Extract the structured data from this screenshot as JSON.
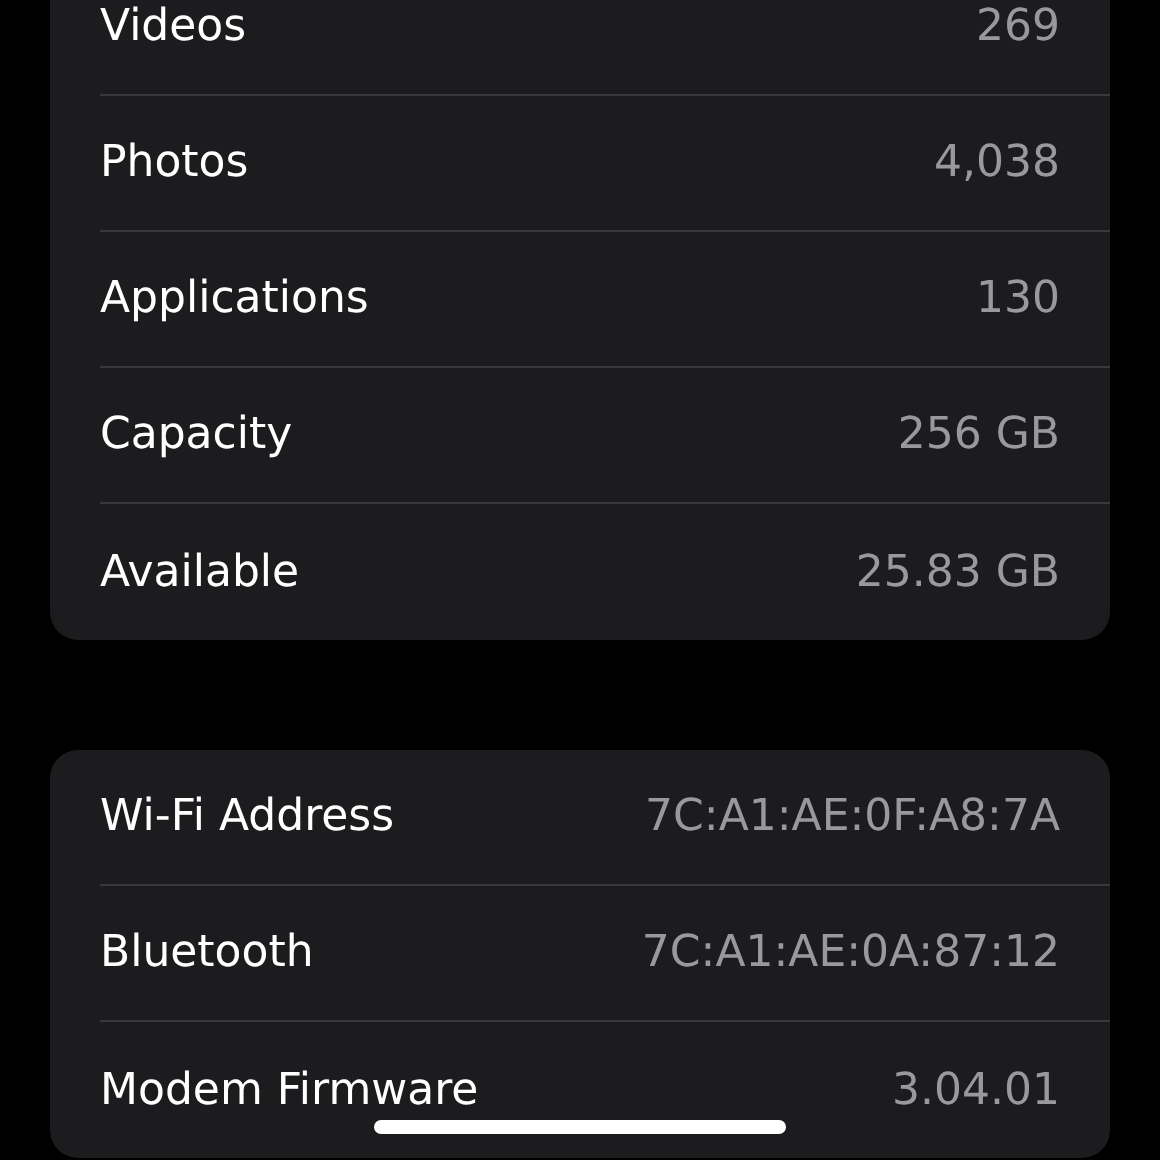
{
  "sections": [
    {
      "rows": [
        {
          "label": "Videos",
          "value": "269"
        },
        {
          "label": "Photos",
          "value": "4,038"
        },
        {
          "label": "Applications",
          "value": "130"
        },
        {
          "label": "Capacity",
          "value": "256 GB"
        },
        {
          "label": "Available",
          "value": "25.83 GB"
        }
      ]
    },
    {
      "rows": [
        {
          "label": "Wi-Fi Address",
          "value": "7C:A1:AE:0F:A8:7A"
        },
        {
          "label": "Bluetooth",
          "value": "7C:A1:AE:0A:87:12"
        },
        {
          "label": "Modem Firmware",
          "value": "3.04.01"
        }
      ]
    }
  ]
}
